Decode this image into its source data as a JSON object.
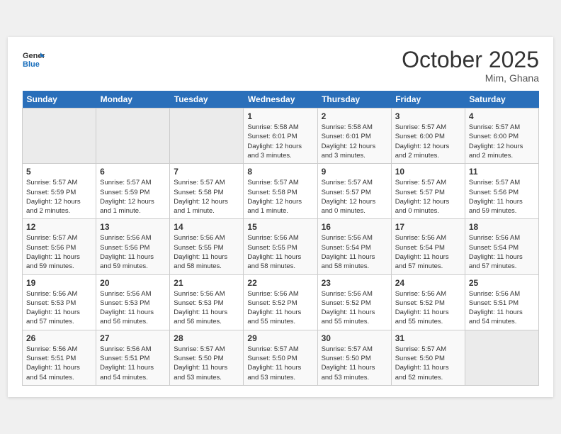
{
  "header": {
    "logo_line1": "General",
    "logo_line2": "Blue",
    "month": "October 2025",
    "location": "Mim, Ghana"
  },
  "weekdays": [
    "Sunday",
    "Monday",
    "Tuesday",
    "Wednesday",
    "Thursday",
    "Friday",
    "Saturday"
  ],
  "weeks": [
    [
      {
        "day": "",
        "info": ""
      },
      {
        "day": "",
        "info": ""
      },
      {
        "day": "",
        "info": ""
      },
      {
        "day": "1",
        "info": "Sunrise: 5:58 AM\nSunset: 6:01 PM\nDaylight: 12 hours\nand 3 minutes."
      },
      {
        "day": "2",
        "info": "Sunrise: 5:58 AM\nSunset: 6:01 PM\nDaylight: 12 hours\nand 3 minutes."
      },
      {
        "day": "3",
        "info": "Sunrise: 5:57 AM\nSunset: 6:00 PM\nDaylight: 12 hours\nand 2 minutes."
      },
      {
        "day": "4",
        "info": "Sunrise: 5:57 AM\nSunset: 6:00 PM\nDaylight: 12 hours\nand 2 minutes."
      }
    ],
    [
      {
        "day": "5",
        "info": "Sunrise: 5:57 AM\nSunset: 5:59 PM\nDaylight: 12 hours\nand 2 minutes."
      },
      {
        "day": "6",
        "info": "Sunrise: 5:57 AM\nSunset: 5:59 PM\nDaylight: 12 hours\nand 1 minute."
      },
      {
        "day": "7",
        "info": "Sunrise: 5:57 AM\nSunset: 5:58 PM\nDaylight: 12 hours\nand 1 minute."
      },
      {
        "day": "8",
        "info": "Sunrise: 5:57 AM\nSunset: 5:58 PM\nDaylight: 12 hours\nand 1 minute."
      },
      {
        "day": "9",
        "info": "Sunrise: 5:57 AM\nSunset: 5:57 PM\nDaylight: 12 hours\nand 0 minutes."
      },
      {
        "day": "10",
        "info": "Sunrise: 5:57 AM\nSunset: 5:57 PM\nDaylight: 12 hours\nand 0 minutes."
      },
      {
        "day": "11",
        "info": "Sunrise: 5:57 AM\nSunset: 5:56 PM\nDaylight: 11 hours\nand 59 minutes."
      }
    ],
    [
      {
        "day": "12",
        "info": "Sunrise: 5:57 AM\nSunset: 5:56 PM\nDaylight: 11 hours\nand 59 minutes."
      },
      {
        "day": "13",
        "info": "Sunrise: 5:56 AM\nSunset: 5:56 PM\nDaylight: 11 hours\nand 59 minutes."
      },
      {
        "day": "14",
        "info": "Sunrise: 5:56 AM\nSunset: 5:55 PM\nDaylight: 11 hours\nand 58 minutes."
      },
      {
        "day": "15",
        "info": "Sunrise: 5:56 AM\nSunset: 5:55 PM\nDaylight: 11 hours\nand 58 minutes."
      },
      {
        "day": "16",
        "info": "Sunrise: 5:56 AM\nSunset: 5:54 PM\nDaylight: 11 hours\nand 58 minutes."
      },
      {
        "day": "17",
        "info": "Sunrise: 5:56 AM\nSunset: 5:54 PM\nDaylight: 11 hours\nand 57 minutes."
      },
      {
        "day": "18",
        "info": "Sunrise: 5:56 AM\nSunset: 5:54 PM\nDaylight: 11 hours\nand 57 minutes."
      }
    ],
    [
      {
        "day": "19",
        "info": "Sunrise: 5:56 AM\nSunset: 5:53 PM\nDaylight: 11 hours\nand 57 minutes."
      },
      {
        "day": "20",
        "info": "Sunrise: 5:56 AM\nSunset: 5:53 PM\nDaylight: 11 hours\nand 56 minutes."
      },
      {
        "day": "21",
        "info": "Sunrise: 5:56 AM\nSunset: 5:53 PM\nDaylight: 11 hours\nand 56 minutes."
      },
      {
        "day": "22",
        "info": "Sunrise: 5:56 AM\nSunset: 5:52 PM\nDaylight: 11 hours\nand 55 minutes."
      },
      {
        "day": "23",
        "info": "Sunrise: 5:56 AM\nSunset: 5:52 PM\nDaylight: 11 hours\nand 55 minutes."
      },
      {
        "day": "24",
        "info": "Sunrise: 5:56 AM\nSunset: 5:52 PM\nDaylight: 11 hours\nand 55 minutes."
      },
      {
        "day": "25",
        "info": "Sunrise: 5:56 AM\nSunset: 5:51 PM\nDaylight: 11 hours\nand 54 minutes."
      }
    ],
    [
      {
        "day": "26",
        "info": "Sunrise: 5:56 AM\nSunset: 5:51 PM\nDaylight: 11 hours\nand 54 minutes."
      },
      {
        "day": "27",
        "info": "Sunrise: 5:56 AM\nSunset: 5:51 PM\nDaylight: 11 hours\nand 54 minutes."
      },
      {
        "day": "28",
        "info": "Sunrise: 5:57 AM\nSunset: 5:50 PM\nDaylight: 11 hours\nand 53 minutes."
      },
      {
        "day": "29",
        "info": "Sunrise: 5:57 AM\nSunset: 5:50 PM\nDaylight: 11 hours\nand 53 minutes."
      },
      {
        "day": "30",
        "info": "Sunrise: 5:57 AM\nSunset: 5:50 PM\nDaylight: 11 hours\nand 53 minutes."
      },
      {
        "day": "31",
        "info": "Sunrise: 5:57 AM\nSunset: 5:50 PM\nDaylight: 11 hours\nand 52 minutes."
      },
      {
        "day": "",
        "info": ""
      }
    ]
  ]
}
